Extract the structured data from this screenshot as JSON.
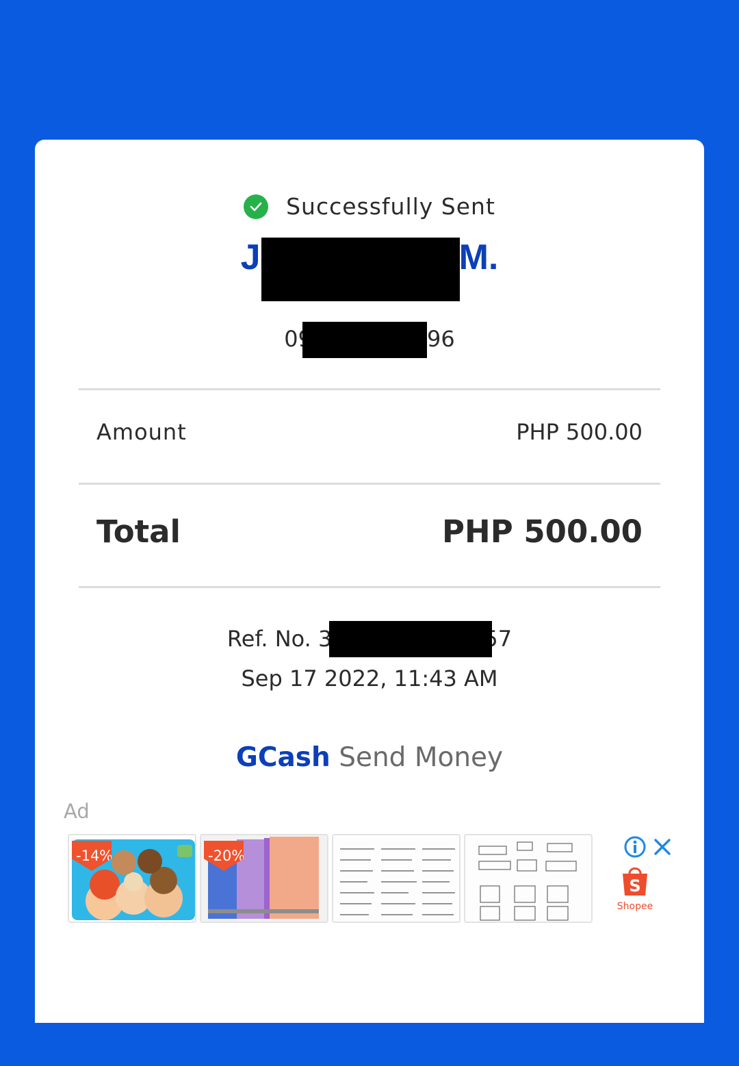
{
  "status": {
    "text": "Successfully Sent"
  },
  "recipient": {
    "name_start": "J",
    "name_end": "M.",
    "phone_start": "09",
    "phone_end": "96"
  },
  "amount": {
    "label": "Amount",
    "value": "PHP 500.00"
  },
  "total": {
    "label": "Total",
    "value": "PHP 500.00"
  },
  "reference": {
    "prefix": "Ref. No. 3",
    "suffix": "57"
  },
  "date": "Sep 17 2022, 11:43 AM",
  "footer": {
    "brand": "GCash",
    "service": "Send Money"
  },
  "ad": {
    "label": "Ad",
    "items": [
      {
        "discount": "-14%",
        "icon": "cartoon-pillow-image"
      },
      {
        "discount": "-20%",
        "icon": "fabric-towels-image"
      },
      {
        "discount": "",
        "icon": "calligraphy-sheet-image"
      },
      {
        "discount": "",
        "icon": "shape-diagram-image"
      }
    ],
    "advertiser": "Shopee"
  },
  "colors": {
    "background": "#0a5be0",
    "brand_blue": "#0c3fb8",
    "success": "#27b14a",
    "shopee": "#ee4d2d"
  }
}
